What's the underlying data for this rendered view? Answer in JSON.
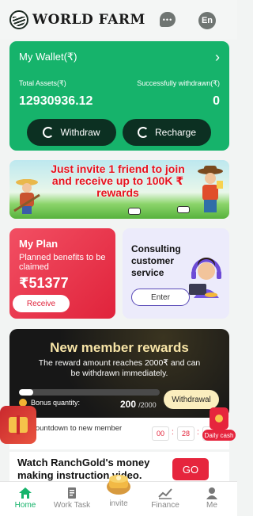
{
  "header": {
    "app_name": "WORLD FARM",
    "lang": "En"
  },
  "wallet": {
    "title": "My Wallet(₹)",
    "total_label": "Total Assets(₹)",
    "total_value": "12930936.12",
    "withdrawn_label": "Successfully withdrawn(₹)",
    "withdrawn_value": "0",
    "withdraw_btn": "Withdraw",
    "recharge_btn": "Recharge"
  },
  "banner": {
    "text": "Just invite 1 friend to join and receive up to 100K ₹ rewards"
  },
  "plan": {
    "title": "My Plan",
    "subtitle": "Planned benefits to be claimed",
    "amount": "₹51377",
    "button": "Receive"
  },
  "consult": {
    "title": "Consulting customer service",
    "button": "Enter"
  },
  "rewards": {
    "title": "New member rewards",
    "desc": "The reward amount reaches 2000₹ and can be withdrawn immediately.",
    "bonus_label": "Bonus quantity:",
    "bonus_value": "200",
    "bonus_total": "/2000",
    "progress": 0.1,
    "withdraw_btn": "Withdrawal"
  },
  "countdown": {
    "label": "Countdown to new member",
    "hh": "00",
    "mm": "28",
    "ss": ""
  },
  "guide": {
    "text": "Watch RanchGold's money making instruction video.",
    "button": "GO"
  },
  "floaters": {
    "daily_cash": "Daily cash"
  },
  "nav": {
    "items": [
      {
        "label": "Home",
        "icon": "home-icon",
        "active": true
      },
      {
        "label": "Work Task",
        "icon": "task-icon",
        "active": false
      },
      {
        "label": "invite",
        "icon": "invite-icon",
        "active": false
      },
      {
        "label": "Finance",
        "icon": "chart-icon",
        "active": false
      },
      {
        "label": "Me",
        "icon": "person-icon",
        "active": false
      }
    ]
  },
  "colors": {
    "brand_green": "#16b36b",
    "accent_red": "#e6253d",
    "dark": "#0c3022"
  }
}
